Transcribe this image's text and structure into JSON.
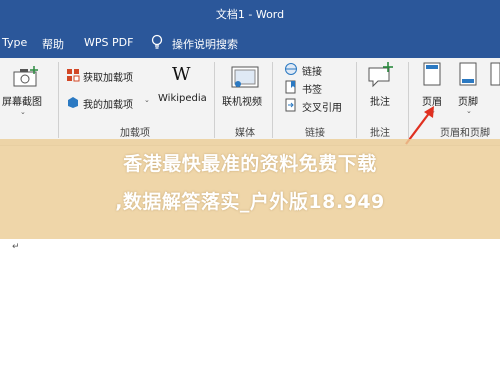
{
  "window": {
    "title": "文档1  -  Word"
  },
  "menu": {
    "items": [
      "Type",
      "帮助",
      "WPS PDF",
      "操作说明搜索"
    ]
  },
  "ribbon": {
    "screenshot_label": "屏幕截图",
    "get_addins": "获取加载项",
    "my_addins": "我的加载项",
    "wikipedia": "Wikipedia",
    "online_video": "联机视频",
    "link": "链接",
    "bookmark": "书签",
    "cross_ref": "交叉引用",
    "comment": "批注",
    "header": "页眉",
    "footer": "页脚",
    "groups": {
      "addins": "加载项",
      "media": "媒体",
      "links": "链接",
      "comments": "批注",
      "header_footer": "页眉和页脚"
    }
  },
  "banner": {
    "line1": "香港最快最准的资料免费下载",
    "line2": ",数据解答落实_户外版18.949"
  },
  "colors": {
    "accent": "#2b579a",
    "arrow": "#e03020"
  }
}
